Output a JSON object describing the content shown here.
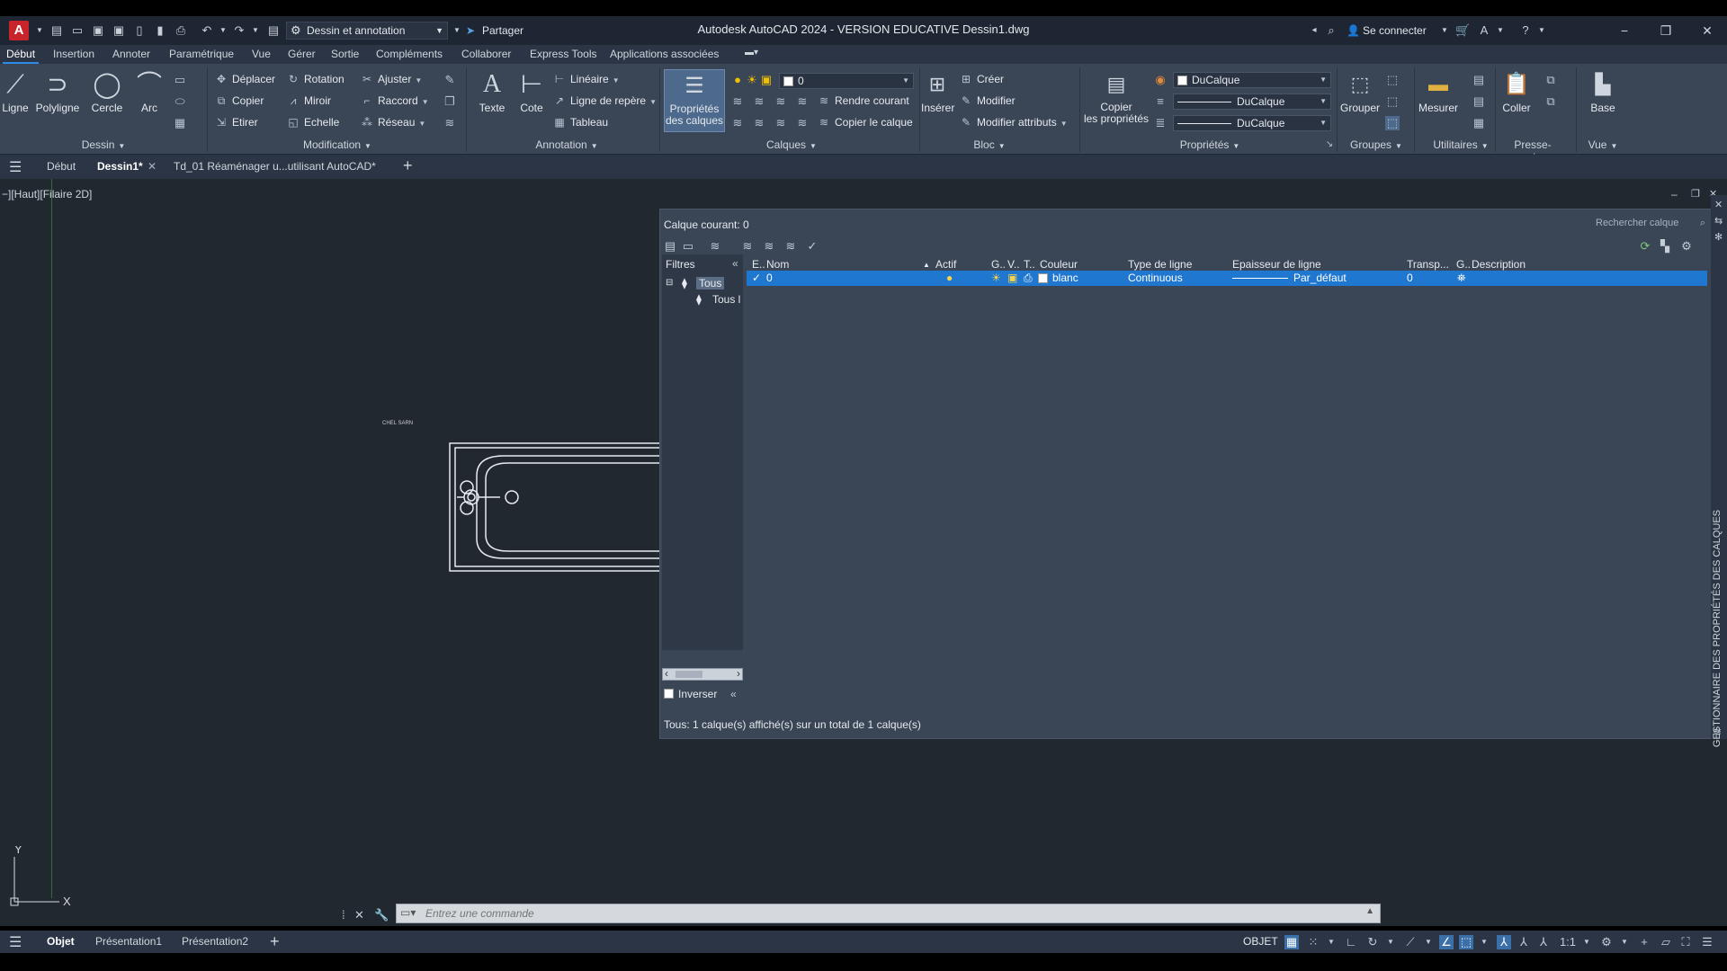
{
  "titlebar": {
    "app_logo": "A",
    "workspace": "Dessin et annotation",
    "share": "Partager",
    "window_title": "Autodesk AutoCAD 2024 - VERSION EDUCATIVE   Dessin1.dwg",
    "login": "Se connecter"
  },
  "ribbon_tabs": [
    "Début",
    "Insertion",
    "Annoter",
    "Paramétrique",
    "Vue",
    "Gérer",
    "Sortie",
    "Compléments",
    "Collaborer",
    "Express Tools",
    "Applications associées"
  ],
  "ribbon": {
    "dessin": {
      "title": "Dessin",
      "ligne": "Ligne",
      "polyligne": "Polyligne",
      "cercle": "Cercle",
      "arc": "Arc"
    },
    "modification": {
      "title": "Modification",
      "deplacer": "Déplacer",
      "rotation": "Rotation",
      "ajuster": "Ajuster",
      "copier": "Copier",
      "miroir": "Miroir",
      "raccord": "Raccord",
      "etirer": "Etirer",
      "echelle": "Echelle",
      "reseau": "Réseau"
    },
    "annotation": {
      "title": "Annotation",
      "texte": "Texte",
      "cote": "Cote",
      "lineaire": "Linéaire",
      "ligne_repere": "Ligne de repère",
      "tableau": "Tableau"
    },
    "calques": {
      "title": "Calques",
      "proprietes_l1": "Propriétés",
      "proprietes_l2": "des calques",
      "current_layer": "0",
      "rendre_courant": "Rendre courant",
      "copier_calque": "Copier le calque"
    },
    "bloc": {
      "title": "Bloc",
      "inserer": "Insérer",
      "creer": "Créer",
      "modifier": "Modifier",
      "modifier_attributs": "Modifier attributs"
    },
    "proprietes": {
      "title": "Propriétés",
      "copier_l1": "Copier",
      "copier_l2": "les propriétés",
      "couleur": "DuCalque",
      "type_ligne": "DuCalque",
      "epaisseur": "DuCalque"
    },
    "groupes": {
      "title": "Groupes",
      "grouper": "Grouper"
    },
    "utilitaires": {
      "title": "Utilitaires",
      "mesurer": "Mesurer"
    },
    "presse_papiers": {
      "title": "Presse-papiers",
      "coller": "Coller"
    },
    "vue": {
      "title": "Vue",
      "base": "Base"
    }
  },
  "doc_tabs": [
    "Début",
    "Dessin1*",
    "Td_01 Réaménager u...utilisant AutoCAD*"
  ],
  "viewport": {
    "label": "−][Haut][Filaire 2D]",
    "drawing_label": "CHEL SARN",
    "axis_y": "Y",
    "axis_x": "X"
  },
  "layer_manager": {
    "current": "Calque courant: 0",
    "search_placeholder": "Rechercher calque",
    "filters_header": "Filtres",
    "tree": [
      "Tous",
      "Tous l"
    ],
    "invert_label": "Inverser",
    "columns": [
      "E..",
      "Nom",
      "Actif",
      "G..",
      "V..",
      "T..",
      "Couleur",
      "Type de ligne",
      "Epaisseur de ligne",
      "Transp...",
      "G..",
      "Description"
    ],
    "rows": [
      {
        "name": "0",
        "color": "blanc",
        "linetype": "Continuous",
        "lineweight": "Par_défaut",
        "transparency": "0"
      }
    ],
    "status": "Tous: 1 calque(s) affiché(s) sur un total de 1 calque(s)",
    "side_title": "GESTIONNAIRE DES PROPRIÉTÉS DES CALQUES"
  },
  "command_line": {
    "placeholder": "Entrez une commande"
  },
  "layout_tabs": [
    "Objet",
    "Présentation1",
    "Présentation2"
  ],
  "status_bar": {
    "model": "OBJET",
    "scale": "1:1"
  },
  "colors": {
    "accent": "#1f77d0",
    "canvas": "#212830",
    "ribbon": "#3a4556"
  }
}
